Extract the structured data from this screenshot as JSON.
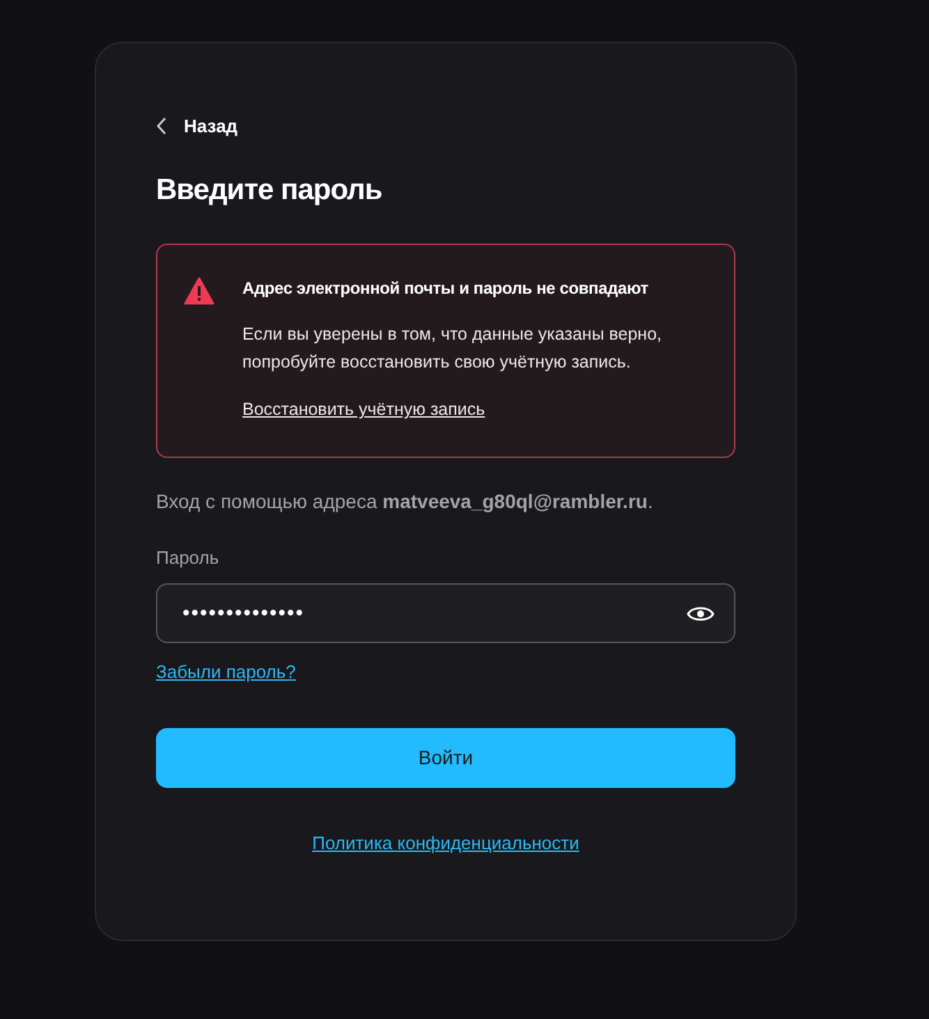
{
  "back": {
    "label": "Назад"
  },
  "title": "Введите пароль",
  "alert": {
    "title": "Адрес электронной почты и пароль не совпадают",
    "text": "Если вы уверены в том, что данные указаны верно, попробуйте восстановить свою учётную запись.",
    "link": "Восстановить учётную запись"
  },
  "login_info": "Вход с помощью адреса **matveeva_g80ql@rambler.ru**.",
  "password": {
    "label": "Пароль",
    "value": "••••••••••••••"
  },
  "forgot_link": "Забыли пароль?",
  "submit": "Войти",
  "privacy_link": "Политика конфиденциальности"
}
